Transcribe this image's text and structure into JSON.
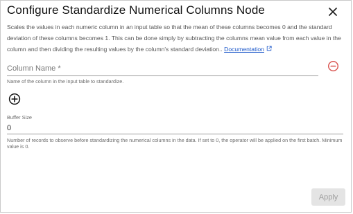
{
  "dialog": {
    "title": "Configure Standardize Numerical Columns Node",
    "description": "Scales the values in each numeric column in an input table so that the mean of these columns becomes 0 and the standard deviation of these columns becomes 1. This can be done simply by subtracting the columns mean value from each value in the column and then dividing the resulting values by the column's standard deviation..",
    "documentation_link": "Documentation"
  },
  "column_name": {
    "placeholder": "Column Name *",
    "value": "",
    "helper": "Name of the column in the input table to standardize."
  },
  "buffer_size": {
    "label": "Buffer Size",
    "value": "0",
    "helper": "Number of records to observe before standardizing the numerical columns in the data. If set to 0, the operator will be applied on the first batch. Minimum value is 0."
  },
  "actions": {
    "apply_label": "Apply"
  },
  "icons": {
    "close": "close-icon",
    "remove": "remove-circle-icon",
    "add": "add-circle-icon",
    "external_link": "external-link-icon"
  },
  "colors": {
    "remove_icon": "#d9534f",
    "link": "#1a56c9",
    "apply_disabled_bg": "#e4e4e4",
    "apply_disabled_text": "#9e9e9e"
  }
}
